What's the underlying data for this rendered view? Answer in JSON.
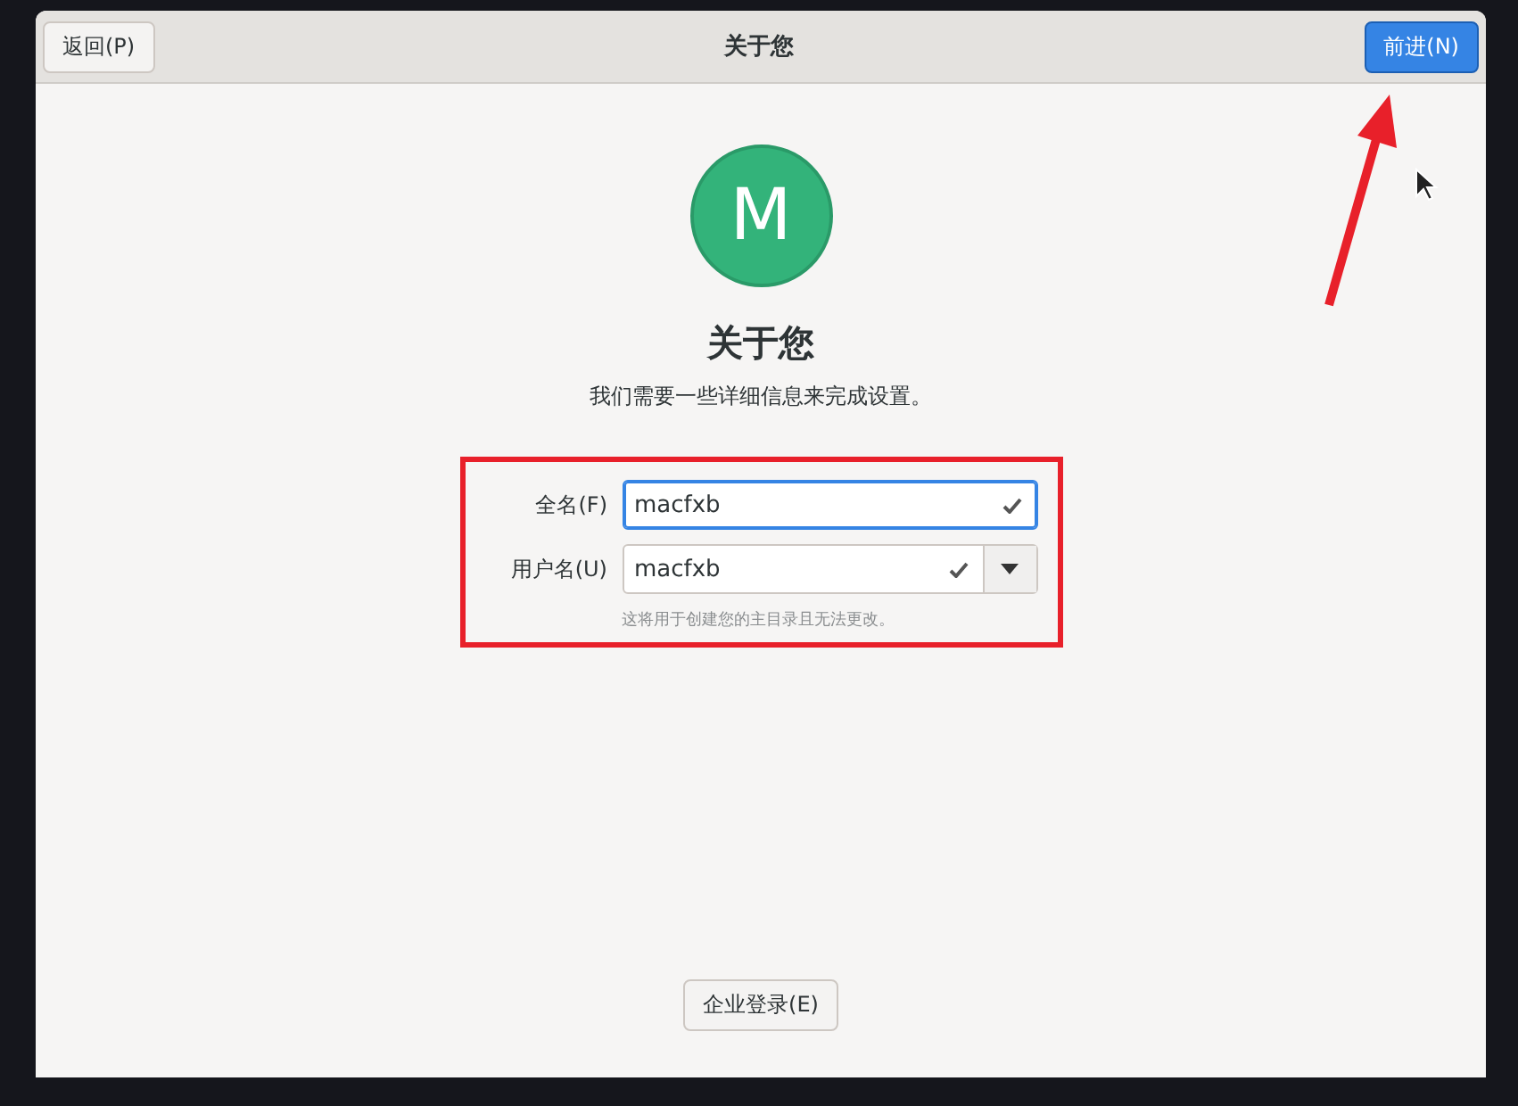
{
  "header": {
    "back_button": "返回(P)",
    "title": "关于您",
    "next_button": "前进(N)"
  },
  "avatar": {
    "letter": "M"
  },
  "heading": "关于您",
  "subtitle": "我们需要一些详细信息来完成设置。",
  "form": {
    "fields": [
      {
        "kind": "text",
        "label": "全名(F)",
        "value": "macfxb",
        "valid": true,
        "focused": true
      },
      {
        "kind": "combo",
        "label": "用户名(U)",
        "value": "macfxb",
        "valid": true,
        "focused": false
      }
    ],
    "hint": "这将用于创建您的主目录且无法更改。"
  },
  "enterprise_button": "企业登录(E)"
}
